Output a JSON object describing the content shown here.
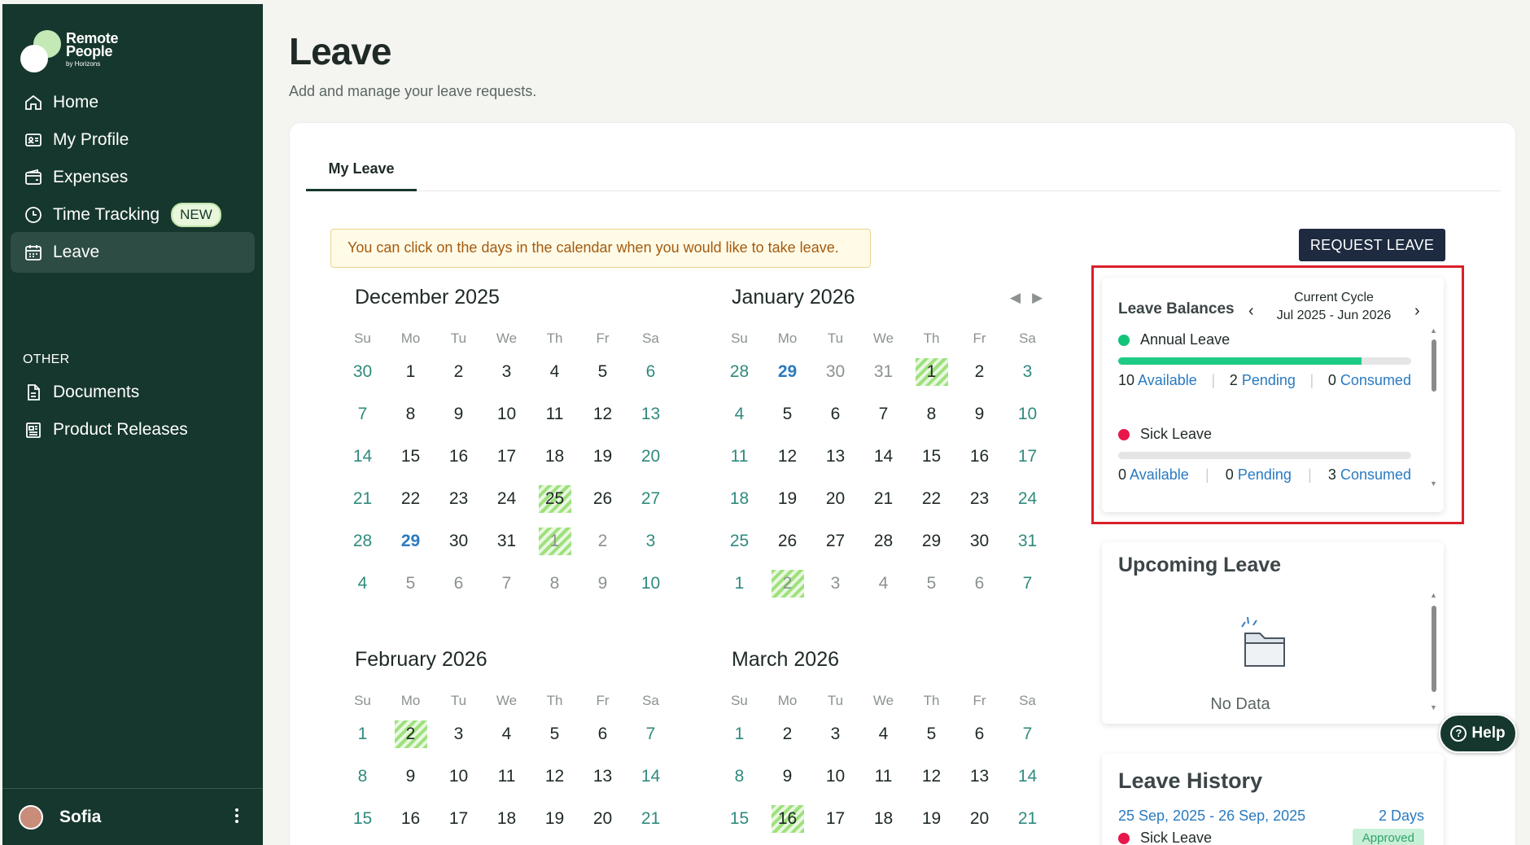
{
  "brand": {
    "line1": "Remote",
    "line2": "People",
    "line3": "by Horizons"
  },
  "nav": {
    "items": [
      {
        "label": "Home",
        "icon": "home-icon"
      },
      {
        "label": "My Profile",
        "icon": "id-card-icon"
      },
      {
        "label": "Expenses",
        "icon": "wallet-icon"
      },
      {
        "label": "Time Tracking",
        "icon": "clock-icon",
        "badge": "NEW"
      },
      {
        "label": "Leave",
        "icon": "calendar-icon",
        "active": true
      }
    ],
    "other_label": "OTHER",
    "other_items": [
      {
        "label": "Documents",
        "icon": "document-icon"
      },
      {
        "label": "Product Releases",
        "icon": "newspaper-icon"
      }
    ]
  },
  "user": {
    "name": "Sofia"
  },
  "page": {
    "title": "Leave",
    "subtitle": "Add and manage your leave requests."
  },
  "tabs": [
    {
      "label": "My Leave",
      "active": true
    }
  ],
  "info_message": "You can click on the days in the calendar when you would like to take leave.",
  "request_button": "REQUEST LEAVE",
  "weekdays": [
    "Su",
    "Mo",
    "Tu",
    "We",
    "Th",
    "Fr",
    "Sa"
  ],
  "calendars": [
    {
      "title": "December 2025",
      "weeks": [
        [
          "30",
          "1",
          "2",
          "3",
          "4",
          "5",
          "6"
        ],
        [
          "7",
          "8",
          "9",
          "10",
          "11",
          "12",
          "13"
        ],
        [
          "14",
          "15",
          "16",
          "17",
          "18",
          "19",
          "20"
        ],
        [
          "21",
          "22",
          "23",
          "24",
          "25",
          "26",
          "27"
        ],
        [
          "28",
          "29",
          "30",
          "31",
          "1",
          "2",
          "3"
        ],
        [
          "4",
          "5",
          "6",
          "7",
          "8",
          "9",
          "10"
        ]
      ]
    },
    {
      "title": "January 2026",
      "weeks": [
        [
          "28",
          "29",
          "30",
          "31",
          "1",
          "2",
          "3"
        ],
        [
          "4",
          "5",
          "6",
          "7",
          "8",
          "9",
          "10"
        ],
        [
          "11",
          "12",
          "13",
          "14",
          "15",
          "16",
          "17"
        ],
        [
          "18",
          "19",
          "20",
          "21",
          "22",
          "23",
          "24"
        ],
        [
          "25",
          "26",
          "27",
          "28",
          "29",
          "30",
          "31"
        ],
        [
          "1",
          "2",
          "3",
          "4",
          "5",
          "6",
          "7"
        ]
      ]
    },
    {
      "title": "February 2026",
      "weeks": [
        [
          "1",
          "2",
          "3",
          "4",
          "5",
          "6",
          "7"
        ],
        [
          "8",
          "9",
          "10",
          "11",
          "12",
          "13",
          "14"
        ],
        [
          "15",
          "16",
          "17",
          "18",
          "19",
          "20",
          "21"
        ]
      ]
    },
    {
      "title": "March 2026",
      "weeks": [
        [
          "1",
          "2",
          "3",
          "4",
          "5",
          "6",
          "7"
        ],
        [
          "8",
          "9",
          "10",
          "11",
          "12",
          "13",
          "14"
        ],
        [
          "15",
          "16",
          "17",
          "18",
          "19",
          "20",
          "21"
        ]
      ]
    }
  ],
  "leave_balances": {
    "title": "Leave Balances",
    "cycle_label": "Current Cycle",
    "cycle_range": "Jul 2025 - Jun 2026",
    "types": [
      {
        "name": "Annual Leave",
        "color": "#12c37a",
        "available": "10",
        "pending": "2",
        "consumed": "0",
        "fill": 0.83
      },
      {
        "name": "Sick Leave",
        "color": "#e8174a",
        "available": "0",
        "pending": "0",
        "consumed": "3",
        "fill": 0
      }
    ],
    "available_label": "Available",
    "pending_label": "Pending",
    "consumed_label": "Consumed"
  },
  "upcoming": {
    "title": "Upcoming Leave",
    "empty": "No Data"
  },
  "history": {
    "title": "Leave History",
    "dates": "25 Sep, 2025 - 26 Sep, 2025",
    "days": "2 Days",
    "type": "Sick Leave",
    "type_color": "#e8174a",
    "status": "Approved"
  },
  "help": "Help",
  "colors": {
    "sidebar": "#16372d",
    "accent": "#2a7ac0",
    "weekend": "#2f8a7e",
    "highlight": "#d9202a"
  }
}
